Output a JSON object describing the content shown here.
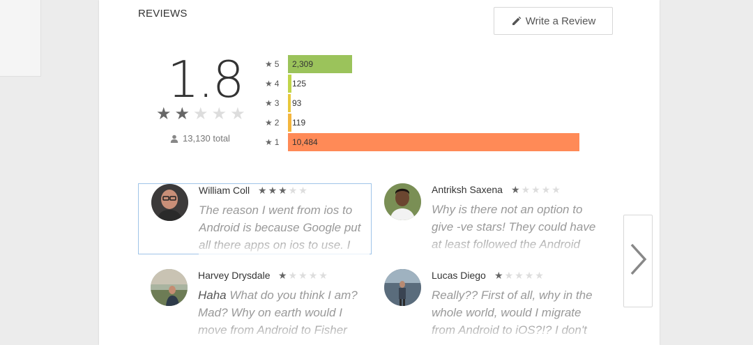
{
  "colors": {
    "star_filled": "#666666",
    "star_empty": "#dddddd",
    "bar_5": "#9bc35b",
    "bar_4": "#c0d54b",
    "bar_3": "#e8c83c",
    "bar_2": "#f4b63e",
    "bar_1": "#ff8a57"
  },
  "reviews_section": {
    "title": "REVIEWS",
    "write_review_label": "Write a Review",
    "write_icon": "pencil-icon"
  },
  "summary": {
    "score": "1.8",
    "stars_filled": 2,
    "stars_total": 5,
    "total_icon": "person-icon",
    "total_text": "13,130 total"
  },
  "histogram": [
    {
      "stars": "5",
      "count": "2,309",
      "fraction": 0.22
    },
    {
      "stars": "4",
      "count": "125",
      "fraction": 0.012
    },
    {
      "stars": "3",
      "count": "93",
      "fraction": 0.009
    },
    {
      "stars": "2",
      "count": "119",
      "fraction": 0.011
    },
    {
      "stars": "1",
      "count": "10,484",
      "fraction": 1.0
    }
  ],
  "reviews": [
    {
      "name": "William Coll",
      "rating": 3,
      "lead": "",
      "text": "The reason I went from ios to Android is because Google put all there apps on ios to use. I",
      "selected": true
    },
    {
      "name": "Antriksh Saxena",
      "rating": 1,
      "lead": "",
      "text": "Why is there not an option to give -ve stars! They could have at least followed the Android",
      "selected": false
    },
    {
      "name": "Harvey Drysdale",
      "rating": 1,
      "lead": "Haha",
      "text": " What do you think I am? Mad? Why on earth would I move from Android to Fisher",
      "selected": false
    },
    {
      "name": "Lucas Diego",
      "rating": 1,
      "lead": "",
      "text": "Really?? First of all, why in the whole world, would I migrate from Android to iOS?!? I don't",
      "selected": false
    }
  ],
  "next_icon": "chevron-right-icon"
}
